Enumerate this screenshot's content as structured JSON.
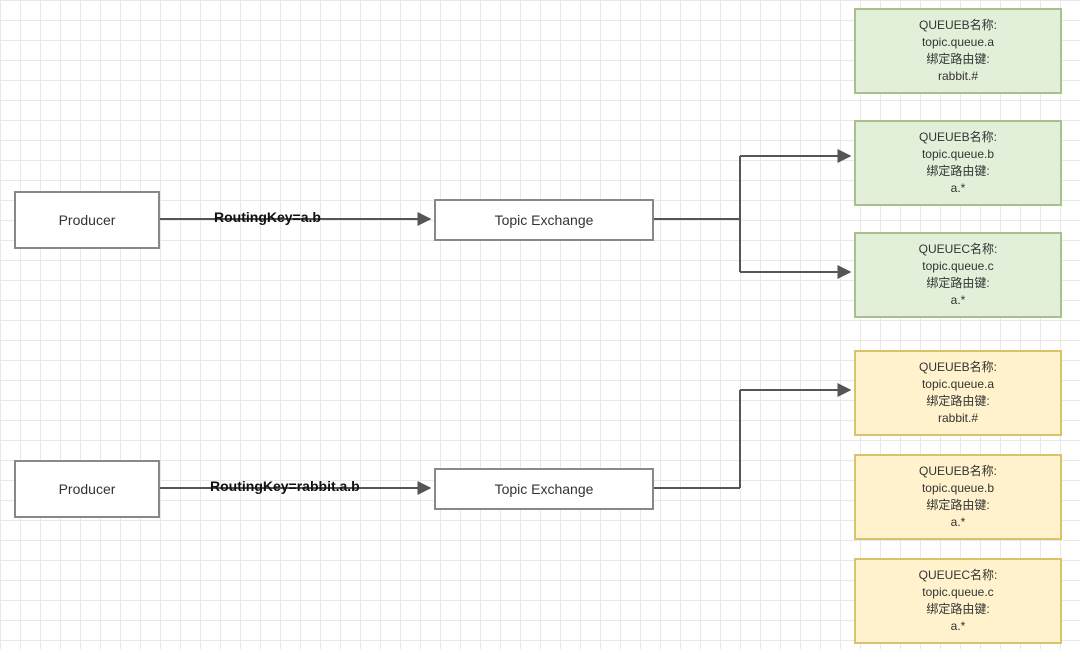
{
  "diagram": {
    "flow1": {
      "producer": "Producer",
      "routing_key_label": "RoutingKey=a.b",
      "exchange": "Topic Exchange"
    },
    "flow2": {
      "producer": "Producer",
      "routing_key_label": "RoutingKey=rabbit.a.b",
      "exchange": "Topic Exchange"
    },
    "queues_green": [
      {
        "title": "QUEUEB名称:",
        "name": "topic.queue.a",
        "bind_label": "绑定路由键:",
        "bind_key": "rabbit.#"
      },
      {
        "title": "QUEUEB名称:",
        "name": "topic.queue.b",
        "bind_label": "绑定路由键:",
        "bind_key": "a.*"
      },
      {
        "title": "QUEUEC名称:",
        "name": "topic.queue.c",
        "bind_label": "绑定路由键:",
        "bind_key": "a.*"
      }
    ],
    "queues_yellow": [
      {
        "title": "QUEUEB名称:",
        "name": "topic.queue.a",
        "bind_label": "绑定路由键:",
        "bind_key": "rabbit.#"
      },
      {
        "title": "QUEUEB名称:",
        "name": "topic.queue.b",
        "bind_label": "绑定路由键:",
        "bind_key": "a.*"
      },
      {
        "title": "QUEUEC名称:",
        "name": "topic.queue.c",
        "bind_label": "绑定路由键:",
        "bind_key": "a.*"
      }
    ]
  },
  "colors": {
    "queue_green_bg": "#e2f0d9",
    "queue_green_border": "#a8c08a",
    "queue_yellow_bg": "#fff2cc",
    "queue_yellow_border": "#d6c36a",
    "connector": "#555555"
  }
}
